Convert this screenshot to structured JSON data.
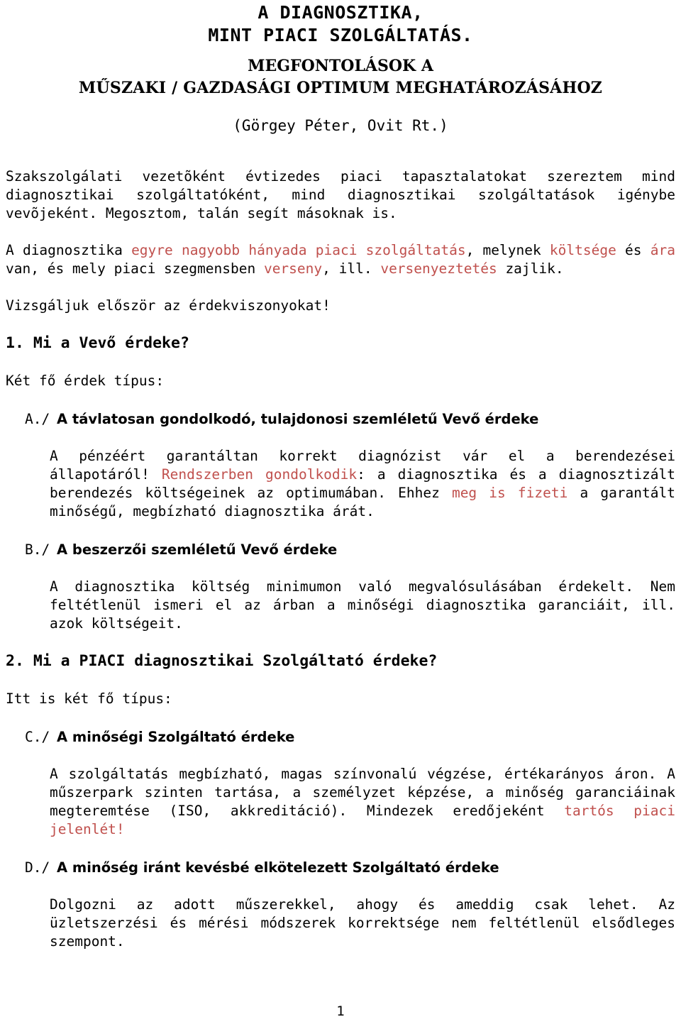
{
  "document": {
    "title_lines": [
      "A DIAGNOSZTIKA,",
      "MINT PIACI SZOLGÁLTATÁS.",
      "MEGFONTOLÁSOK A",
      "MŰSZAKI / GAZDASÁGI OPTIMUM MEGHATÁROZÁSÁHOZ"
    ],
    "author": "(Görgey Péter, Ovit Rt.)",
    "page_number": "1",
    "accent_color": "#c0504d"
  },
  "intro": {
    "paragraph_1": "Szakszolgálati vezetõként évtizedes piaci tapasztalatokat szereztem mind diagnosztikai szolgáltatóként, mind diagnosztikai szolgáltatások igénybe vevõjeként. Megosztom, talán segít másoknak is.",
    "paragraph_2": {
      "seg_1": "A diagnosztika ",
      "seg_2_red": "egyre nagyobb hányada piaci szolgáltatás",
      "seg_3": ", melynek ",
      "seg_4_red": "költsége",
      "seg_5": " és ",
      "seg_6_red": "ára",
      "seg_7": " van, és mely piaci szegmensben ",
      "seg_8_red": "verseny",
      "seg_9": ", ill. ",
      "seg_10_red": "versenyeztetés",
      "seg_11": " zajlik."
    },
    "paragraph_3": "Vizsgáljuk először az érdekviszonyokat!"
  },
  "section_1": {
    "heading": "1. Mi a Vevő érdeke?",
    "lead_in": "Két fő érdek típus:",
    "items": [
      {
        "marker": "A./",
        "heading": "A távlatosan gondolkodó, tulajdonosi szemléletű Vevő érdeke",
        "body": {
          "seg_1": "A pénzéért garantáltan korrekt diagnózist vár el a berendezései állapotáról! ",
          "seg_2_red": "Rendszerben gondolkodik",
          "seg_3": ": a diagnosztika és a diagnosztizált berendezés költségeinek az optimumában. Ehhez ",
          "seg_4_red": "meg is fizeti",
          "seg_5": " a garantált minőségű, megbízható diagnosztika árát."
        }
      },
      {
        "marker": "B./",
        "heading": "A beszerzői szemléletű Vevő érdeke",
        "body": {
          "seg_1": "A diagnosztika költség minimumon való megvalósulásában érdekelt. Nem feltétlenül ismeri el az árban a minőségi diagnosztika garanciáit, ill. azok költségeit."
        }
      }
    ]
  },
  "section_2": {
    "heading": "2. Mi a PIACI diagnosztikai Szolgáltató érdeke?",
    "lead_in": "Itt is két fő típus:",
    "items": [
      {
        "marker": "C./",
        "heading": "A minőségi Szolgáltató érdeke",
        "body": {
          "seg_1": "A szolgáltatás megbízható, magas színvonalú végzése, értékarányos áron. A műszerpark szinten tartása, a személyzet képzése, a minőség garanciáinak megteremtése (ISO, akkreditáció). Mindezek eredőjeként ",
          "seg_2_red": "tartós piaci jelenlét!"
        }
      },
      {
        "marker": "D./",
        "heading": "A minőség iránt kevésbé elkötelezett Szolgáltató érdeke",
        "body": {
          "seg_1": "Dolgozni az adott műszerekkel, ahogy és ameddig csak lehet. Az üzletszerzési és mérési módszerek korrektsége nem feltétlenül elsődleges szempont."
        }
      }
    ]
  }
}
